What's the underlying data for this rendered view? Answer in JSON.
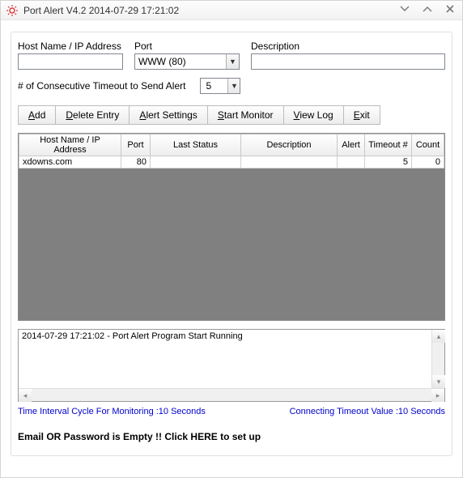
{
  "titlebar": {
    "title": "Port Alert V4.2 2014-07-29 17:21:02"
  },
  "labels": {
    "host": "Host Name / IP Address",
    "port": "Port",
    "desc": "Description",
    "timeout_label": "# of Consecutive Timeout to Send Alert"
  },
  "inputs": {
    "host_value": "",
    "port_value": "WWW   (80)",
    "desc_value": "",
    "timeout_value": "5"
  },
  "toolbar": {
    "add": "Add",
    "delete": "Delete Entry",
    "alert_settings": "Alert Settings",
    "start_monitor": "Start Monitor",
    "view_log": "View Log",
    "exit": "Exit"
  },
  "grid": {
    "headers": {
      "host": "Host Name / IP Address",
      "port": "Port",
      "last_status": "Last Status",
      "desc": "Description",
      "alert": "Alert",
      "timeout_num": "Timeout #",
      "count": "Count"
    },
    "rows": [
      {
        "host": "xdowns.com",
        "port": "80",
        "last_status": "",
        "desc": "",
        "alert": "",
        "timeout_num": "5",
        "count": "0"
      }
    ]
  },
  "log": {
    "line1": "2014-07-29 17:21:02 - Port Alert Program Start Running"
  },
  "status": {
    "left": "Time Interval Cycle For Monitoring :10 Seconds",
    "right": "Connecting Timeout Value :10 Seconds"
  },
  "warning": "Email OR Password is Empty !! Click HERE to set up"
}
